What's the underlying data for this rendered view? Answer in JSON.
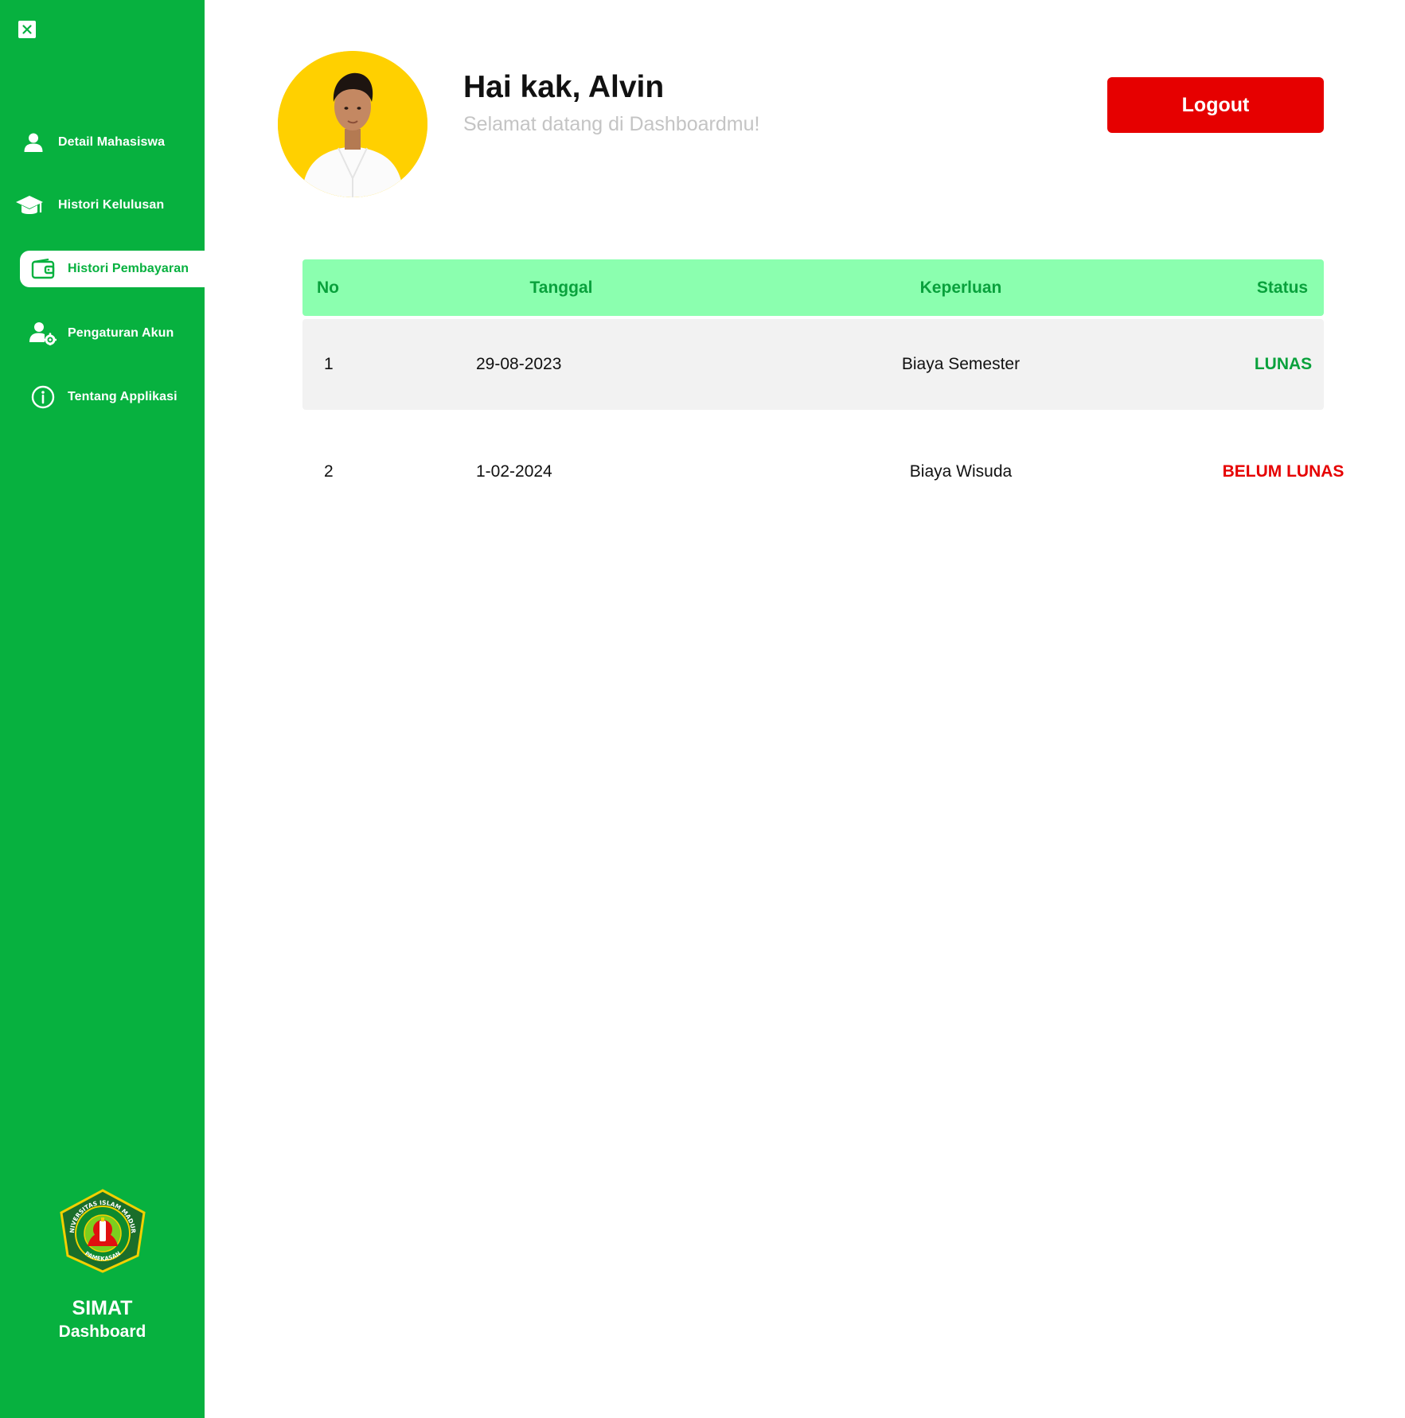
{
  "sidebar": {
    "close_icon": "close-icon",
    "items": [
      {
        "label": "Detail Mahasiswa",
        "icon": "user-icon",
        "active": false
      },
      {
        "label": "Histori Kelulusan",
        "icon": "graduation-cap-icon",
        "active": false
      },
      {
        "label": "Histori Pembayaran",
        "icon": "wallet-icon",
        "active": true
      },
      {
        "label": "Pengaturan Akun",
        "icon": "user-settings-icon",
        "active": false
      },
      {
        "label": "Tentang Applikasi",
        "icon": "info-icon",
        "active": false
      }
    ],
    "logo_text_top": "UNIVERSITAS ISLAM MADURA",
    "logo_text_bottom": "PAMEKASAN",
    "brand_title": "SIMAT",
    "brand_subtitle": "Dashboard"
  },
  "header": {
    "greeting": "Hai kak, Alvin",
    "welcome": "Selamat datang di Dashboardmu!",
    "logout_label": "Logout"
  },
  "table": {
    "columns": [
      "No",
      "Tanggal",
      "Keperluan",
      "Status"
    ],
    "rows": [
      {
        "no": "1",
        "tanggal": "29-08-2023",
        "keperluan": "Biaya Semester",
        "status": "LUNAS"
      },
      {
        "no": "2",
        "tanggal": "1-02-2024",
        "keperluan": "Biaya Wisuda",
        "status": "BELUM LUNAS"
      }
    ]
  },
  "colors": {
    "sidebar": "#07b13f",
    "table_header": "#8bffaf",
    "status_lunas": "#09a13c",
    "status_belum_lunas": "#e60000",
    "logout": "#e60000",
    "avatar_bg": "#ffd000"
  }
}
